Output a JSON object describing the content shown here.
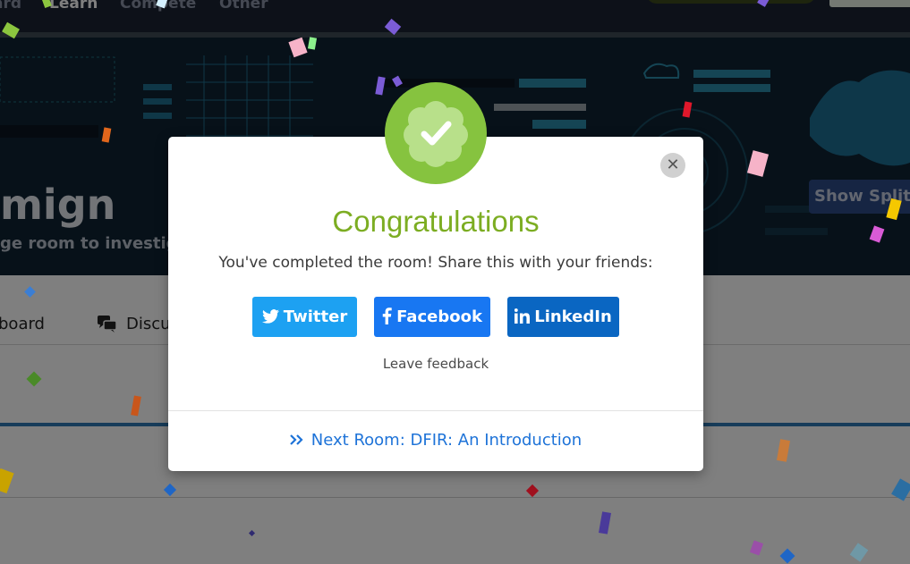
{
  "topnav": {
    "items": [
      "ard",
      "Learn",
      "Compete",
      "Other"
    ]
  },
  "hero": {
    "title": "mign",
    "subtitle": "ge room to investigat",
    "split_view_button": "Show Split V"
  },
  "content": {
    "tabs": [
      {
        "label": "board",
        "icon": "leaderboard-icon"
      },
      {
        "label": "Discu",
        "icon": "discussion-icon"
      }
    ]
  },
  "modal": {
    "badge_icon": "check-badge-icon",
    "close_icon": "close-icon",
    "title": "Congratulations",
    "message": "You've completed the room! Share this with your friends:",
    "share_buttons": [
      {
        "label": "Twitter",
        "icon": "twitter-icon",
        "color": "#1da1f2"
      },
      {
        "label": "Facebook",
        "icon": "facebook-icon",
        "color": "#1877f2"
      },
      {
        "label": "LinkedIn",
        "icon": "linkedin-icon",
        "color": "#0a66c2"
      }
    ],
    "feedback_link": "Leave feedback",
    "next_room": {
      "label": "Next Room: DFIR: An Introduction",
      "icon": "double-chevron-right-icon"
    }
  },
  "colors": {
    "title_green": "#7cad22",
    "badge_green": "#86c33f",
    "link_blue": "#1e73d8"
  }
}
